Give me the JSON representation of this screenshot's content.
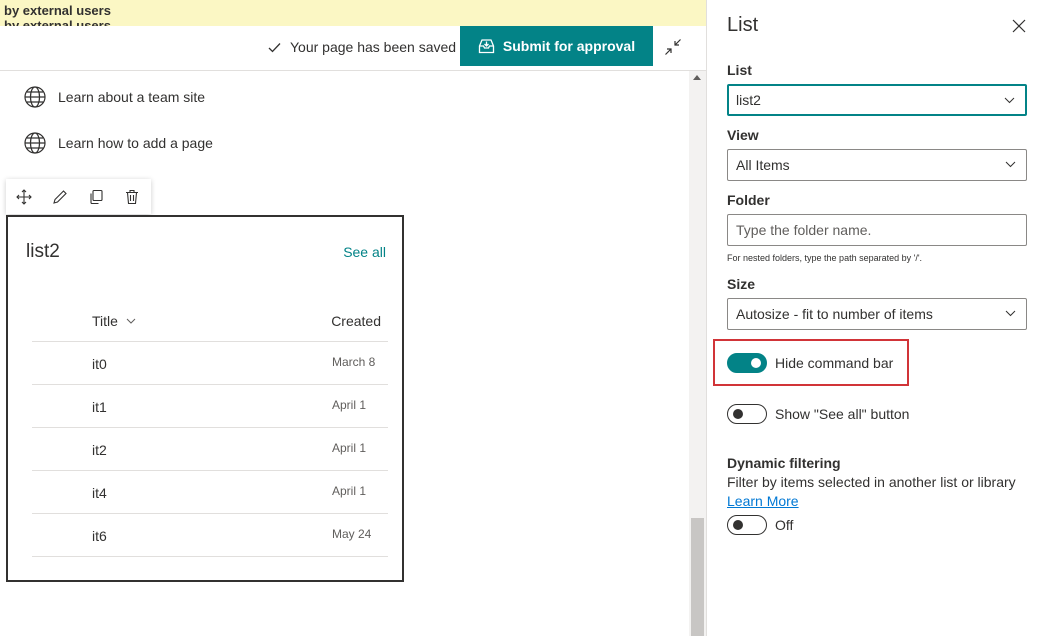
{
  "banner": {
    "line1": "by external users",
    "line2": "by external users"
  },
  "topbar": {
    "saved_text": "Your page has been saved",
    "submit_label": "Submit for approval"
  },
  "quicklinks": [
    {
      "label": "Learn about a team site",
      "icon": "globe-icon"
    },
    {
      "label": "Learn how to add a page",
      "icon": "globe-icon"
    }
  ],
  "toolbar": {
    "icons": [
      "move-icon",
      "edit-icon",
      "duplicate-icon",
      "delete-icon"
    ]
  },
  "webpart": {
    "title": "list2",
    "see_all": "See all",
    "columns": {
      "title": "Title",
      "created": "Created"
    },
    "rows": [
      {
        "title": "it0",
        "created": "March 8"
      },
      {
        "title": "it1",
        "created": "April 1"
      },
      {
        "title": "it2",
        "created": "April 1"
      },
      {
        "title": "it4",
        "created": "April 1"
      },
      {
        "title": "it6",
        "created": "May 24"
      }
    ]
  },
  "pane": {
    "title": "List",
    "list_label": "List",
    "list_value": "list2",
    "view_label": "View",
    "view_value": "All Items",
    "folder_label": "Folder",
    "folder_placeholder": "Type the folder name.",
    "folder_hint": "For nested folders, type the path separated by '/'.",
    "size_label": "Size",
    "size_value": "Autosize - fit to number of items",
    "hide_command_bar_label": "Hide command bar",
    "hide_command_bar_on": true,
    "show_see_all_label": "Show \"See all\" button",
    "show_see_all_on": false,
    "dynamic_filtering_title": "Dynamic filtering",
    "dynamic_filtering_desc": "Filter by items selected in another list or library",
    "learn_more": "Learn More",
    "dynamic_state_label": "Off",
    "dynamic_filtering_on": false
  },
  "colors": {
    "accent": "#038387",
    "highlight": "#d13438",
    "banner": "#fbf7c4",
    "link": "#0078d4"
  }
}
